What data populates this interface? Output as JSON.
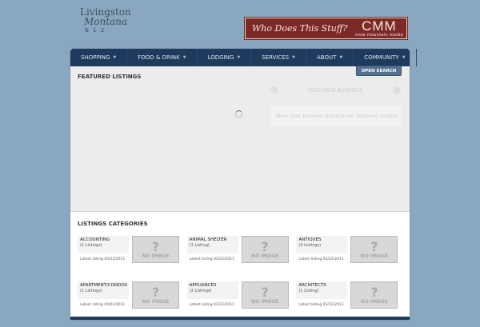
{
  "logo": {
    "line1": "Livingston",
    "line2": "Montana",
    "line3": "biz"
  },
  "banner": {
    "tagline": "Who Does This Stuff?",
    "mark": "CMM",
    "sub": "crow mountain media"
  },
  "nav": [
    {
      "label": "SHOPPING"
    },
    {
      "label": "FOOD & DRINK"
    },
    {
      "label": "LODGING"
    },
    {
      "label": "SERVICES"
    },
    {
      "label": "ABOUT"
    },
    {
      "label": "COMMUNITY"
    }
  ],
  "featured": {
    "title": "FEATURED LISTINGS",
    "search_button": "OPEN SEARCH",
    "business_label": "FEATURED BUSINESS",
    "business_text": "Have your business listed in our Featured section.",
    "prev": "‹",
    "next": "›"
  },
  "categories": {
    "title": "LISTINGS CATEGORIES",
    "no_image_q": "?",
    "no_image_text": "NO IMAGE",
    "items": [
      {
        "name": "ACCOUNTING",
        "count": "(1 Listings)",
        "latest": "Latest listing 03/22/2011"
      },
      {
        "name": "ANIMAL SHELTER",
        "count": "(1 Listing)",
        "latest": "Latest listing 03/22/2011"
      },
      {
        "name": "ANTIQUES",
        "count": "(4 Listings)",
        "latest": "Latest listing 03/22/2011"
      },
      {
        "name": "APARTMENT/CONDOS",
        "count": "(1 Listings)",
        "latest": "Latest listing 04/01/2011"
      },
      {
        "name": "APPLIANCES",
        "count": "(2 Listings)",
        "latest": "Latest listing 03/22/2011"
      },
      {
        "name": "ARCHITECTS",
        "count": "(1 Listing)",
        "latest": "Latest listing 03/22/2011"
      }
    ]
  }
}
